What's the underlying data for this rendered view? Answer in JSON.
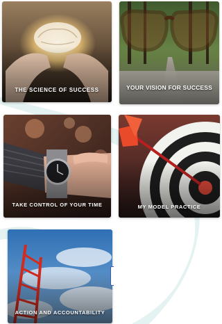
{
  "tiles": [
    {
      "id": "science",
      "label": "THE SCIENCE OF SUCCESS",
      "image": "glowing-brain-in-hands"
    },
    {
      "id": "vision",
      "label": "YOUR VISION FOR SUCCESS",
      "image": "eyeglasses-forest-road"
    },
    {
      "id": "time",
      "label": "TAKE CONTROL OF YOUR TIME",
      "image": "wristwatch-bokeh"
    },
    {
      "id": "practice",
      "label": "MY MODEL PRACTICE",
      "image": "dart-in-bullseye"
    },
    {
      "id": "action",
      "label": "ACTION AND ACCOUNTABILITY",
      "image": "red-ladder-sky"
    }
  ],
  "colors": {
    "swoosh": "#e4f2f1",
    "label_text": "#ffffff",
    "handle_border": "#3b5fa8"
  }
}
